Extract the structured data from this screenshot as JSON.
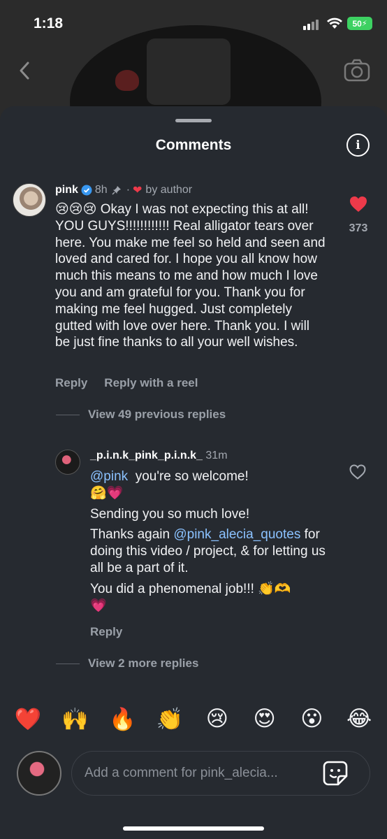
{
  "status": {
    "time": "1:18",
    "battery": "50"
  },
  "sheet": {
    "title": "Comments"
  },
  "comment": {
    "username": "pink",
    "age": "8h",
    "by_author": "by author",
    "emojis": "😢😢😢",
    "text": "Okay I was not expecting this at all! YOU GUYS!!!!!!!!!!!! Real alligator tears over here. You make me feel so held and seen and loved and cared for. I hope you all know how much this means to me and how much I love you and am grateful for you. Thank you for making me feel hugged. Just completely gutted with love over here. Thank you. I will be just fine thanks to all your well wishes.",
    "like_count": "373",
    "reply_label": "Reply",
    "reply_reel_label": "Reply with a reel",
    "view_previous": "View 49 previous replies"
  },
  "reply": {
    "username": "_p.i.n.k_pink_p.i.n.k_",
    "age": "31m",
    "mention1": "@pink",
    "line1": "you're so welcome!",
    "line1_emojis": "🤗💗",
    "line2": "Sending you so much love!",
    "line3_pre": "Thanks again",
    "mention2": "@pink_alecia_quotes",
    "line3_post": "for doing this video / project, & for letting us all be a part of it.",
    "line4": "You did a phenomenal job!!! 👏🫶",
    "line4_emoji": "💗",
    "reply_label": "Reply",
    "view_more": "View 2 more replies"
  },
  "quick_emojis": [
    "❤️",
    "🙌",
    "🔥",
    "👏",
    "😢",
    "😍",
    "😮",
    "😂"
  ],
  "composer": {
    "placeholder": "Add a comment for pink_alecia..."
  },
  "icons": {
    "back": "chevron-left-icon",
    "camera": "camera-icon",
    "info": "info-icon",
    "like": "heart-icon",
    "sticker": "sticker-icon"
  },
  "colors": {
    "like": "#ed3a4a",
    "mention": "#8bc2ff",
    "verified": "#3897f0"
  }
}
